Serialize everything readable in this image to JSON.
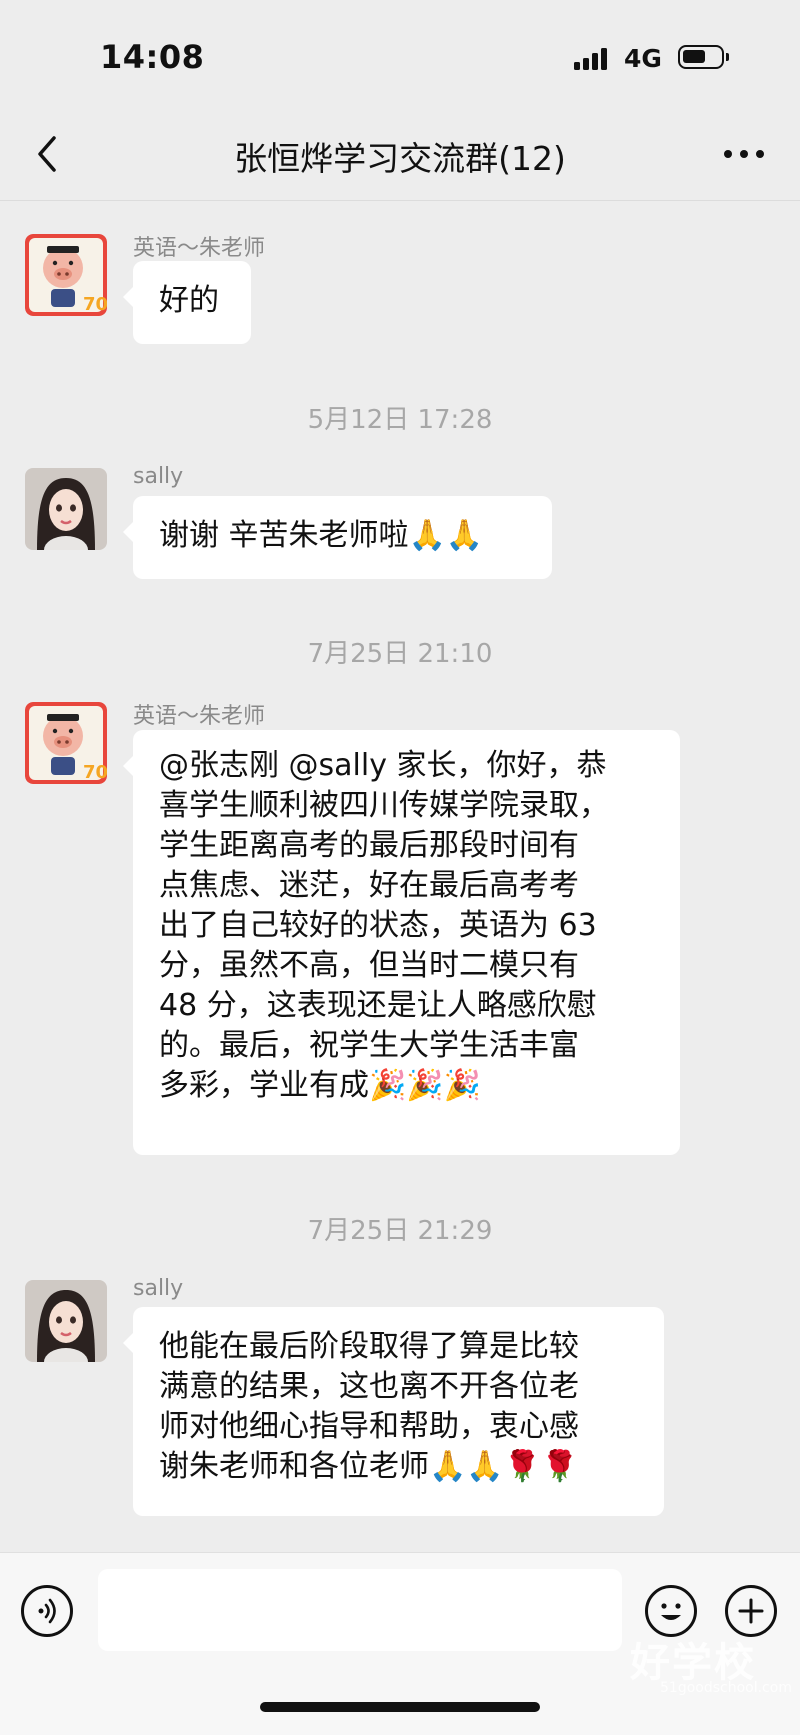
{
  "status_bar": {
    "time": "14:08",
    "network": "4G"
  },
  "nav": {
    "title": "张恒烨学习交流群(12)"
  },
  "messages": [
    {
      "sender": "英语～朱老师",
      "lines": [
        "好的"
      ]
    },
    {
      "timestamp": "5月12日 17:28"
    },
    {
      "sender": "sally",
      "lines": [
        "谢谢 辛苦朱老师啦🙏🙏"
      ]
    },
    {
      "timestamp": "7月25日 21:10"
    },
    {
      "sender": "英语～朱老师",
      "lines": [
        "@张志刚 @sally 家长，你好，恭",
        "喜学生顺利被四川传媒学院录取，",
        "学生距离高考的最后那段时间有",
        "点焦虑、迷茫，好在最后高考考",
        "出了自己较好的状态，英语为 63",
        "分，虽然不高，但当时二模只有",
        "48 分，这表现还是让人略感欣慰",
        "的。最后，祝学生大学生活丰富",
        "多彩，学业有成🎉🎉🎉"
      ]
    },
    {
      "timestamp": "7月25日 21:29"
    },
    {
      "sender": "sally",
      "lines": [
        "他能在最后阶段取得了算是比较",
        "满意的结果，这也离不开各位老",
        "师对他细心指导和帮助，衷心感",
        "谢朱老师和各位老师🙏🙏🌹🌹"
      ]
    }
  ],
  "input": {
    "placeholder": ""
  },
  "watermark": {
    "text": "好学校",
    "sub": "51goodschool.com"
  },
  "colors": {
    "background": "#ededed",
    "bubble": "#ffffff",
    "timestamp": "#a7a7a7"
  },
  "icons": [
    "back-arrow-icon",
    "more-dots-icon",
    "voice-icon",
    "emoji-icon",
    "plus-icon",
    "signal-icon",
    "battery-icon"
  ]
}
